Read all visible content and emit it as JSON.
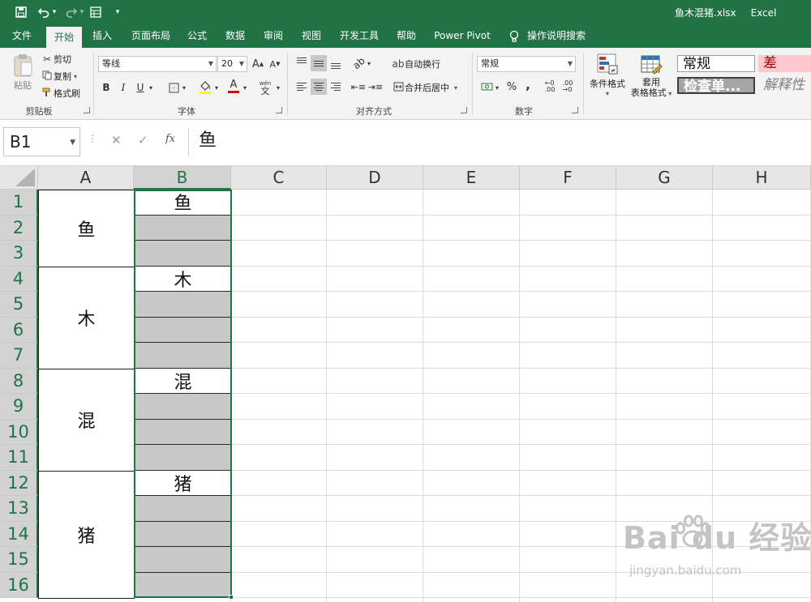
{
  "window": {
    "file_name": "鱼木混猪.xlsx",
    "app_name": "Excel"
  },
  "quick_access": {
    "icons": [
      "save-icon",
      "undo-icon",
      "redo-icon",
      "form-icon",
      "customize-icon"
    ],
    "undo_arrow": "▾",
    "redo_arrow": "▾",
    "customize_arrow": "▾"
  },
  "ribbon_tabs": [
    "文件",
    "开始",
    "插入",
    "页面布局",
    "公式",
    "数据",
    "审阅",
    "视图",
    "开发工具",
    "帮助",
    "Power Pivot",
    "操作说明搜索"
  ],
  "active_tab_index": 1,
  "clipboard": {
    "paste": "粘贴",
    "cut": "剪切",
    "copy": "复制",
    "format_painter": "格式刷",
    "group_label": "剪贴板"
  },
  "font": {
    "name": "等线",
    "size": "20",
    "grow": "A",
    "shrink": "A",
    "bold": "B",
    "italic": "I",
    "underline": "U",
    "font_color_letter": "A",
    "phonetic_top": "wén",
    "phonetic_bottom": "文",
    "group_label": "字体"
  },
  "alignment": {
    "wrap_text": "自动换行",
    "merge_center": "合并后居中",
    "group_label": "对齐方式"
  },
  "number": {
    "format": "常规",
    "percent": "%",
    "comma": ",",
    "group_label": "数字"
  },
  "styles": {
    "conditional_formatting": "条件格式",
    "format_as_table_line1": "套用",
    "format_as_table_line2": "表格格式",
    "cell_styles": [
      "常规",
      "差",
      "检查单...",
      "解释性"
    ],
    "colors": {
      "normal_bg": "#ffffff",
      "bad_bg": "#ffc7ce",
      "bad_text": "#9c0006",
      "check_bg": "#a5a5a5",
      "explanatory_text": "#7f7f7f"
    }
  },
  "formula_bar": {
    "name_box": "B1",
    "cancel_icon": "✕",
    "enter_icon": "✓",
    "fx_label": "fx",
    "content": "鱼"
  },
  "sheet": {
    "columns": [
      "A",
      "B",
      "C",
      "D",
      "E",
      "F",
      "G",
      "H"
    ],
    "rows": [
      "1",
      "2",
      "3",
      "4",
      "5",
      "6",
      "7",
      "8",
      "9",
      "10",
      "11",
      "12",
      "13",
      "14",
      "15",
      "16"
    ],
    "selected_column": "B",
    "merged_a": [
      "鱼",
      "木",
      "混",
      "猪"
    ],
    "b_values": [
      "鱼",
      "",
      "",
      "木",
      "",
      "",
      "",
      "混",
      "",
      "",
      "",
      "猪",
      "",
      "",
      "",
      ""
    ],
    "b_fill": [
      "white",
      "gray",
      "gray",
      "white",
      "gray",
      "gray",
      "gray",
      "white",
      "gray",
      "gray",
      "gray",
      "white",
      "gray",
      "gray",
      "gray",
      "gray"
    ],
    "colors": {
      "accent": "#217346",
      "gray_fill": "#c9c8c9"
    }
  },
  "watermark": {
    "main": "Bai  du 经验",
    "sub": "jingyan.baidu.com"
  }
}
